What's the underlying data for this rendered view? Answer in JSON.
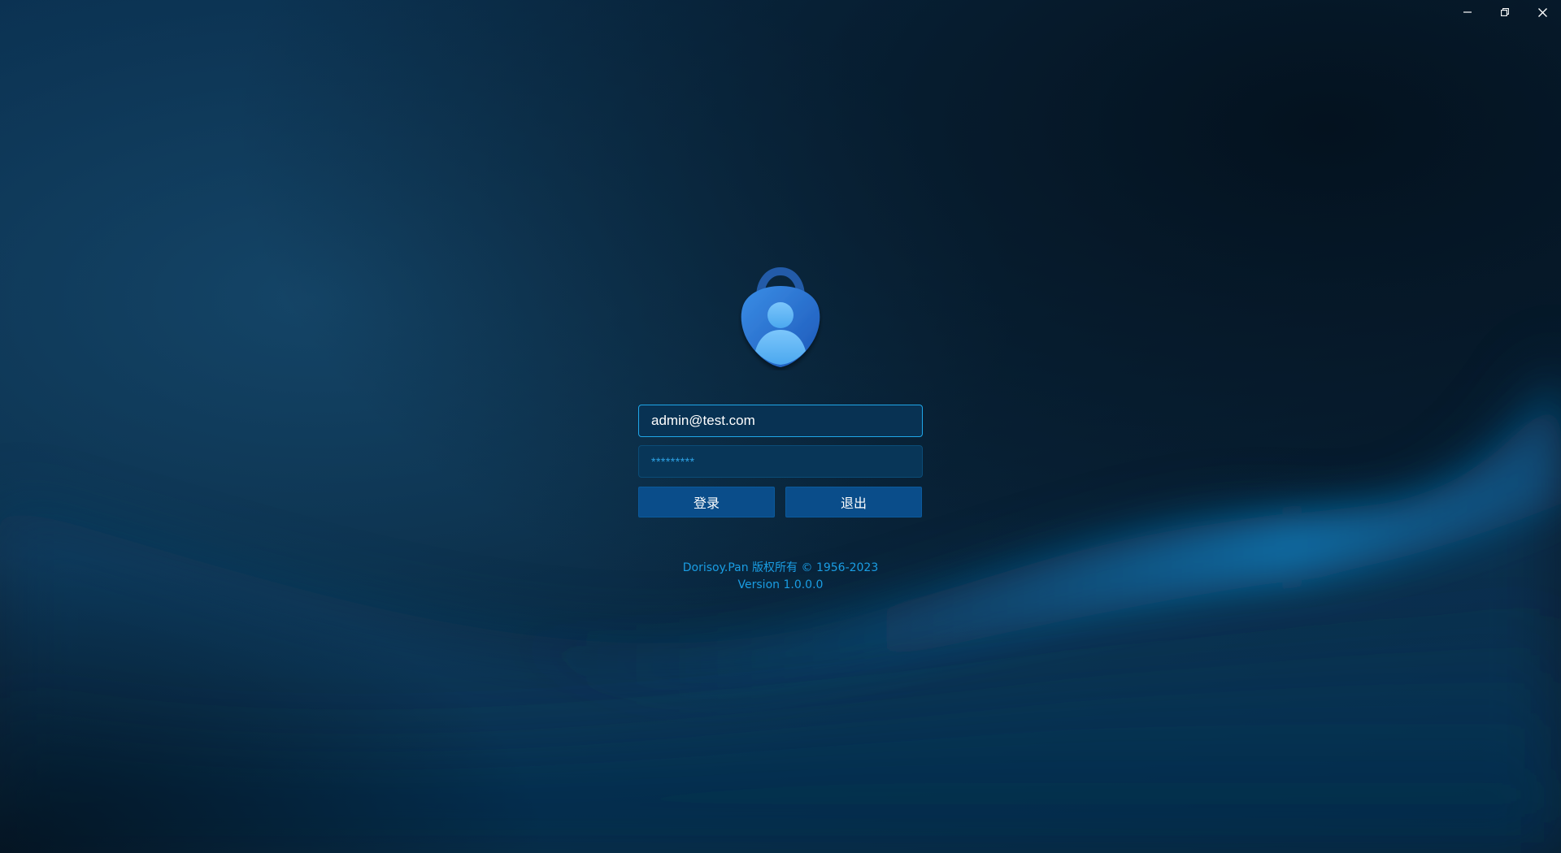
{
  "window": {
    "controls": [
      "minimize-icon",
      "restore-icon",
      "close-icon"
    ]
  },
  "login": {
    "logo_icon": "lock-user-icon",
    "username_value": "admin@test.com",
    "password_mask": "*********",
    "login_label": "登录",
    "exit_label": "退出"
  },
  "footer": {
    "copyright": "Dorisoy.Pan 版权所有 © 1956-2023",
    "version": "Version 1.0.0.0"
  },
  "colors": {
    "background": "#082236",
    "accent": "#1a9de3",
    "button": "#0a4d8a",
    "input_border_focus": "#1fa6e8"
  }
}
